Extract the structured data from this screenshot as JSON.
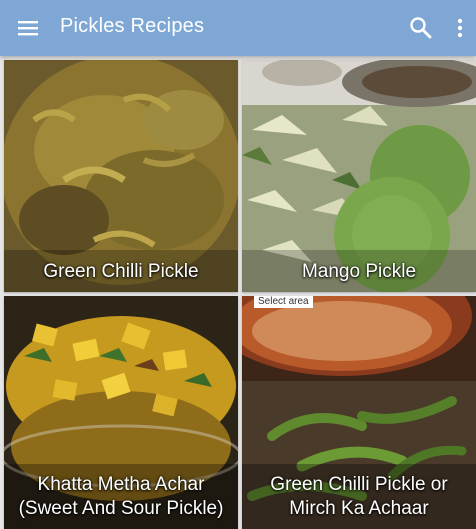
{
  "app": {
    "title": "Pickles Recipes",
    "bar_color": "#7fa7d6",
    "icons": {
      "menu": "menu-icon",
      "search": "search-icon",
      "overflow": "more-vert-icon"
    }
  },
  "recipes": [
    {
      "name": "Green Chilli Pickle"
    },
    {
      "name": "Mango Pickle"
    },
    {
      "name": "Khatta Metha Achar (Sweet And Sour Pickle)"
    },
    {
      "name": "Green Chilli Pickle or Mirch Ka Achaar",
      "overlay_label": "Select area"
    }
  ]
}
